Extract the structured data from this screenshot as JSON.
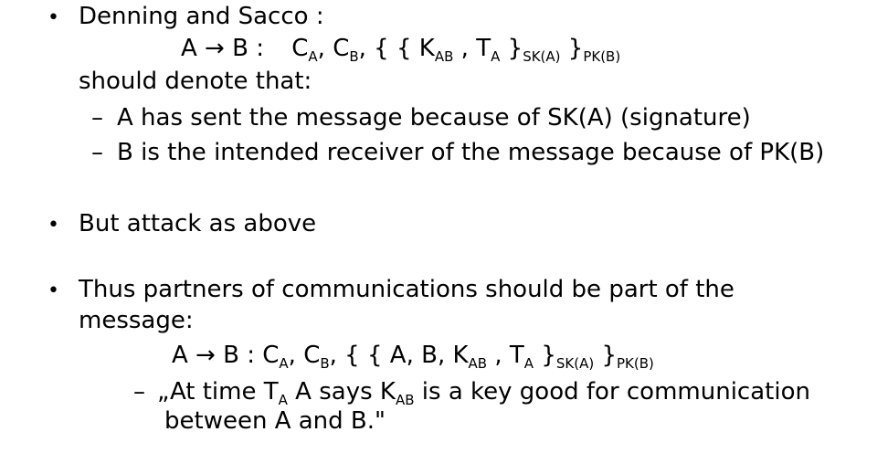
{
  "bullets": [
    {
      "marker": "•",
      "text": "Denning and Sacco :",
      "formula": {
        "lhs": "A → B :",
        "c_a": "C",
        "c_a_sub": "A",
        "c_b": "C",
        "c_b_sub": "B",
        "open": "{ {",
        "k": "K",
        "k_sub": "AB",
        "t": "T",
        "t_sub": "A",
        "close_inner": "}",
        "close_inner_sub": "SK(A)",
        "close_outer": "}",
        "close_outer_sub": "PK(B)"
      },
      "continuation": "should denote that:",
      "subitems": [
        {
          "marker": "–",
          "text": "A has sent the message because of SK(A) (signature)"
        },
        {
          "marker": "–",
          "text": "B is the intended receiver of the message because of PK(B)"
        }
      ]
    },
    {
      "marker": "•",
      "text": "But attack as above"
    },
    {
      "marker": "•",
      "text_line1": "Thus partners of communications should be part of the",
      "text_line2": "message:",
      "formula": {
        "lhs": "A → B :",
        "c_a": "C",
        "c_a_sub": "A",
        "c_b": "C",
        "c_b_sub": "B",
        "open": "{ { A, B,",
        "k": "K",
        "k_sub": "AB",
        "t": "T",
        "t_sub": "A",
        "close_inner": "}",
        "close_inner_sub": "SK(A)",
        "close_outer": "}",
        "close_outer_sub": "PK(B)"
      },
      "quote": {
        "marker": "–",
        "part1": "„At time T",
        "t_sub": "A",
        "part2": "A says K",
        "k_sub": "AB",
        "part3": "is a key good for communication",
        "line2": "between A and B.\""
      }
    }
  ]
}
